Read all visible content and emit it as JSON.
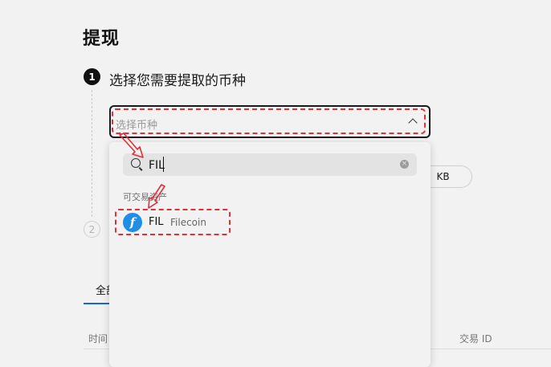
{
  "page": {
    "title": "提现"
  },
  "steps": [
    {
      "number": "1",
      "title": "选择您需要提取的币种"
    },
    {
      "number": "2"
    }
  ],
  "coin_select": {
    "placeholder": "选择币种",
    "expanded": true
  },
  "dropdown": {
    "search_value": "FIL",
    "section_label": "可交易资产",
    "items": [
      {
        "symbol": "FIL",
        "name": "Filecoin",
        "icon_glyph": "f",
        "icon_color": "#1e8ee6"
      }
    ]
  },
  "background": {
    "pill_text": "OKB",
    "tab_label": "全部",
    "table_headers": {
      "time": "时间",
      "tx_id": "交易 ID"
    }
  },
  "annotation": {
    "highlight_color": "#e0303a"
  }
}
